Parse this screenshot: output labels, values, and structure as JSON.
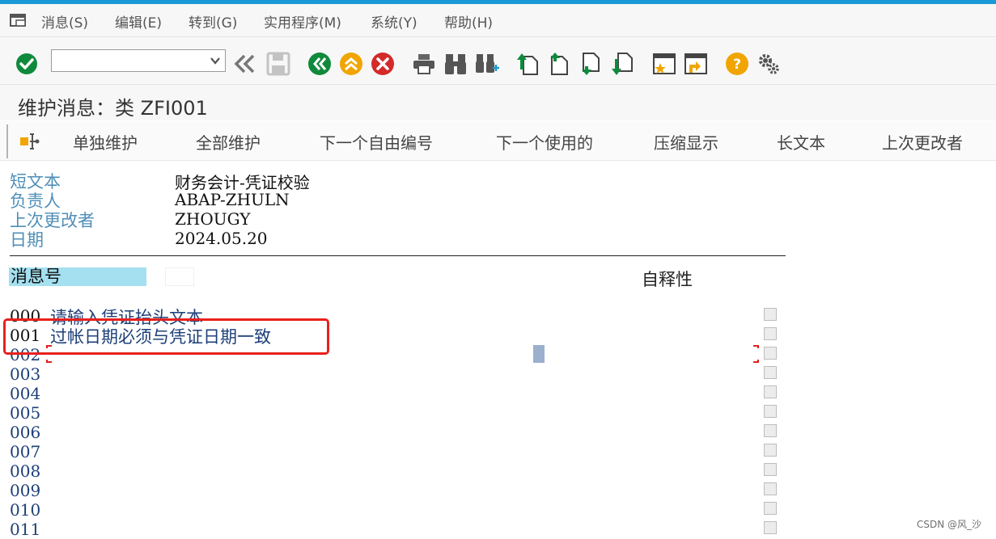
{
  "menu": {
    "items": [
      {
        "label": "消息(S)"
      },
      {
        "label": "编辑(E)"
      },
      {
        "label": "转到(G)"
      },
      {
        "label": "实用程序(M)"
      },
      {
        "label": "系统(Y)"
      },
      {
        "label": "帮助(H)"
      }
    ]
  },
  "toolbar": {
    "command_field_value": "",
    "icons": [
      "enter-icon",
      "command-dropdown-icon",
      "collapse-icon",
      "save-icon",
      "back-icon",
      "exit-icon",
      "cancel-icon",
      "print-icon",
      "find-icon",
      "find-next-icon",
      "first-page-icon",
      "previous-page-icon",
      "next-page-icon",
      "last-page-icon",
      "create-session-icon",
      "shortcut-icon",
      "help-icon",
      "settings-icon"
    ]
  },
  "title": "维护消息：类 ZFI001",
  "app_toolbar": {
    "buttons": [
      {
        "label": "单独维护"
      },
      {
        "label": "全部维护"
      },
      {
        "label": "下一个自由编号"
      },
      {
        "label": "下一个使用的"
      },
      {
        "label": "压缩显示"
      },
      {
        "label": "长文本"
      },
      {
        "label": "上次更改者"
      }
    ]
  },
  "header": {
    "fields": [
      {
        "label": "短文本",
        "value": "财务会计-凭证校验"
      },
      {
        "label": "负责人",
        "value": "ABAP-ZHULN"
      },
      {
        "label": "上次更改者",
        "value": "ZHOUGY"
      },
      {
        "label": "日期",
        "value": "2024.05.20"
      }
    ]
  },
  "table": {
    "col_message_no": "消息号",
    "col_self_explanatory": "自释性",
    "rows": [
      {
        "no": "000",
        "text": "请输入凭证抬头文本"
      },
      {
        "no": "001",
        "text": "过帐日期必须与凭证日期一致"
      },
      {
        "no": "002",
        "text": ""
      },
      {
        "no": "003",
        "text": ""
      },
      {
        "no": "004",
        "text": ""
      },
      {
        "no": "005",
        "text": ""
      },
      {
        "no": "006",
        "text": ""
      },
      {
        "no": "007",
        "text": ""
      },
      {
        "no": "008",
        "text": ""
      },
      {
        "no": "009",
        "text": ""
      },
      {
        "no": "010",
        "text": ""
      },
      {
        "no": "011",
        "text": ""
      }
    ]
  },
  "watermark": "CSDN @风_沙",
  "colors": {
    "accent_blue": "#1a9ad6",
    "label_blue": "#4f8fb8",
    "row_text_blue": "#1d3f78",
    "header_highlight": "#a4e0f0",
    "annotation_red": "#e8211d",
    "sap_green": "#0f8a3c",
    "sap_red": "#d42a2a",
    "sap_orange": "#f0a500"
  }
}
